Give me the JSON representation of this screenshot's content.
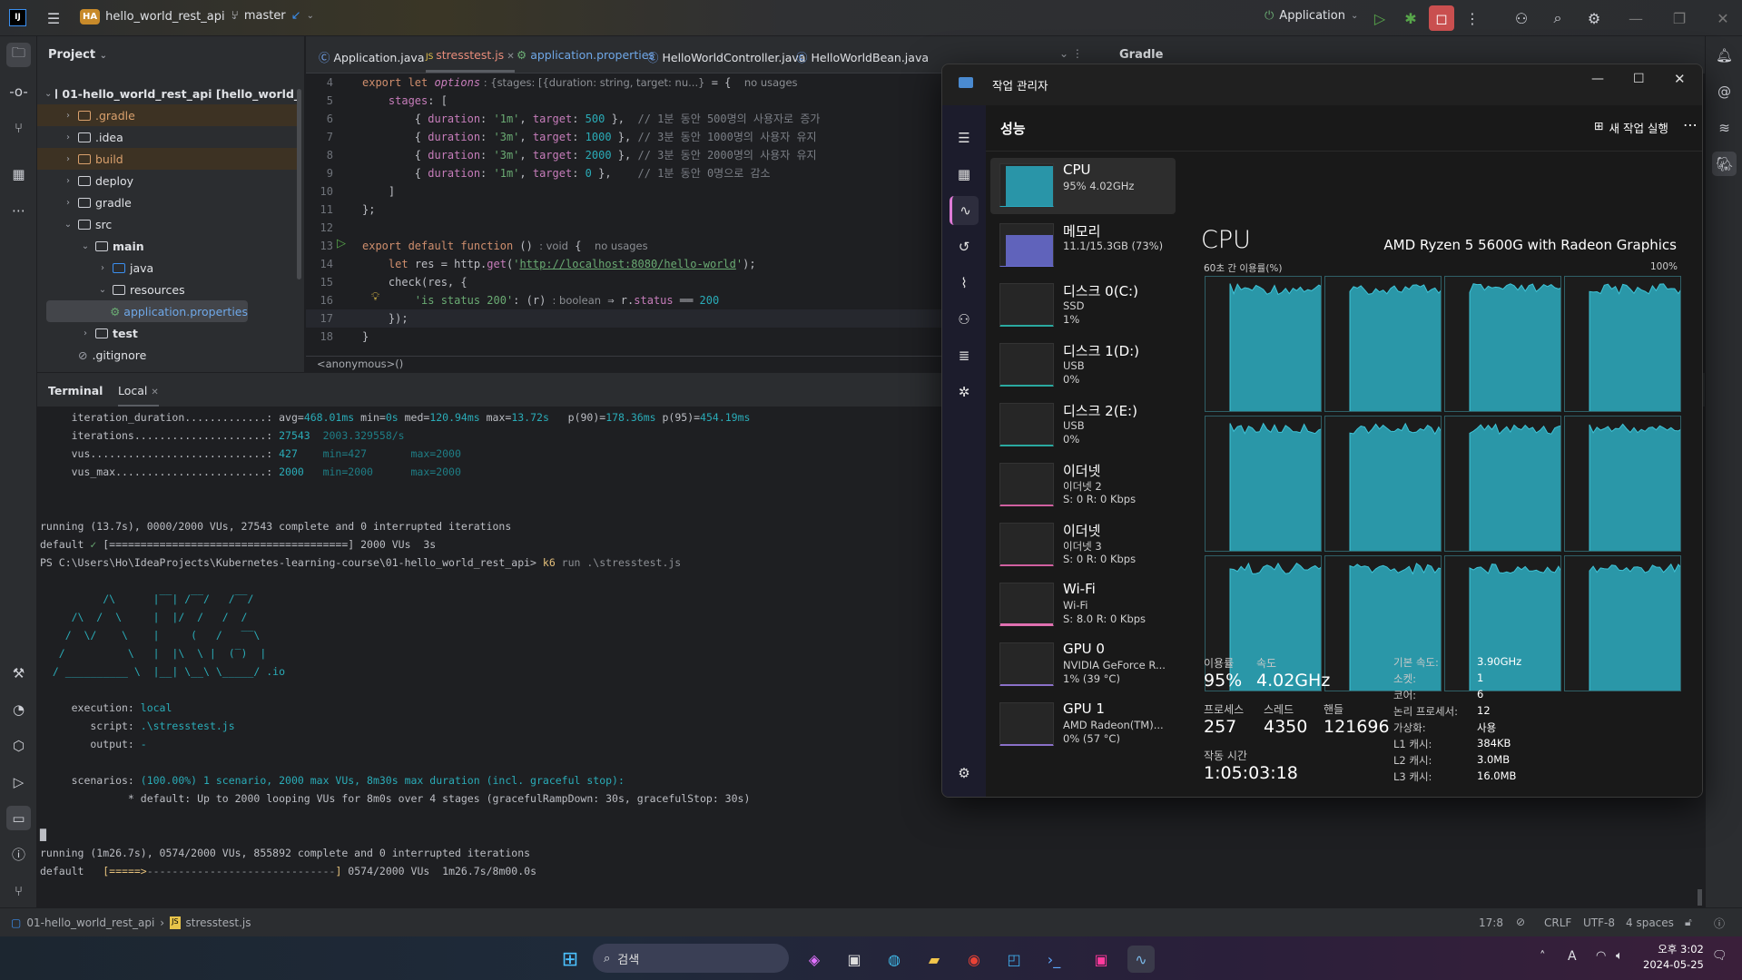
{
  "ide": {
    "project_badge": "HA",
    "project_name": "hello_world_rest_api",
    "branch": "master",
    "run_config": "Application",
    "project_panel_title": "Project",
    "tree": [
      {
        "label": "01-hello_world_rest_api [hello_world_rest_api]",
        "depth": 0,
        "chev": "⌄",
        "type": "module"
      },
      {
        "label": ".gradle",
        "depth": 1,
        "chev": "›",
        "type": "excluded"
      },
      {
        "label": ".idea",
        "depth": 1,
        "chev": "›",
        "type": "folder"
      },
      {
        "label": "build",
        "depth": 1,
        "chev": "›",
        "type": "excluded"
      },
      {
        "label": "deploy",
        "depth": 1,
        "chev": "›",
        "type": "folder"
      },
      {
        "label": "gradle",
        "depth": 1,
        "chev": "›",
        "type": "folder"
      },
      {
        "label": "src",
        "depth": 1,
        "chev": "⌄",
        "type": "folder"
      },
      {
        "label": "main",
        "depth": 2,
        "chev": "⌄",
        "type": "folder"
      },
      {
        "label": "java",
        "depth": 3,
        "chev": "›",
        "type": "folder"
      },
      {
        "label": "resources",
        "depth": 3,
        "chev": "⌄",
        "type": "folder"
      },
      {
        "label": "application.properties",
        "depth": 4,
        "chev": "",
        "type": "selected"
      },
      {
        "label": "test",
        "depth": 2,
        "chev": "›",
        "type": "folder"
      },
      {
        "label": ".gitignore",
        "depth": 1,
        "chev": "",
        "type": "file"
      }
    ],
    "tabs": [
      "Application.java",
      "stresstest.js",
      "application.properties",
      "HelloWorldController.java",
      "HelloWorldBean.java"
    ],
    "active_tab": "stresstest.js",
    "gradle_title": "Gradle",
    "code": [
      {
        "n": "4",
        "seg": [
          [
            "kw",
            "export let "
          ],
          [
            "it",
            "options"
          ],
          [
            "hint",
            " : {stages: [{duration: string, target: nu...}  "
          ],
          [
            "plain",
            "= {  "
          ],
          [
            "hint",
            "no usages"
          ]
        ]
      },
      {
        "n": "5",
        "seg": [
          [
            "plain",
            "    "
          ],
          [
            "prop",
            "stages"
          ],
          [
            "plain",
            ": ["
          ]
        ]
      },
      {
        "n": "6",
        "seg": [
          [
            "plain",
            "        { "
          ],
          [
            "prop",
            "duration"
          ],
          [
            "plain",
            ": "
          ],
          [
            "str",
            "'1m'"
          ],
          [
            "plain",
            ", "
          ],
          [
            "prop",
            "target"
          ],
          [
            "plain",
            ": "
          ],
          [
            "num",
            "500"
          ],
          [
            "plain",
            " },  "
          ],
          [
            "cmt",
            "// 1분 동안 500명의 사용자로 증가"
          ]
        ]
      },
      {
        "n": "7",
        "seg": [
          [
            "plain",
            "        { "
          ],
          [
            "prop",
            "duration"
          ],
          [
            "plain",
            ": "
          ],
          [
            "str",
            "'3m'"
          ],
          [
            "plain",
            ", "
          ],
          [
            "prop",
            "target"
          ],
          [
            "plain",
            ": "
          ],
          [
            "num",
            "1000"
          ],
          [
            "plain",
            " }, "
          ],
          [
            "cmt",
            "// 3분 동안 1000명의 사용자 유지"
          ]
        ]
      },
      {
        "n": "8",
        "seg": [
          [
            "plain",
            "        { "
          ],
          [
            "prop",
            "duration"
          ],
          [
            "plain",
            ": "
          ],
          [
            "str",
            "'3m'"
          ],
          [
            "plain",
            ", "
          ],
          [
            "prop",
            "target"
          ],
          [
            "plain",
            ": "
          ],
          [
            "num",
            "2000"
          ],
          [
            "plain",
            " }, "
          ],
          [
            "cmt",
            "// 3분 동안 2000명의 사용자 유지"
          ]
        ]
      },
      {
        "n": "9",
        "seg": [
          [
            "plain",
            "        { "
          ],
          [
            "prop",
            "duration"
          ],
          [
            "plain",
            ": "
          ],
          [
            "str",
            "'1m'"
          ],
          [
            "plain",
            ", "
          ],
          [
            "prop",
            "target"
          ],
          [
            "plain",
            ": "
          ],
          [
            "num",
            "0"
          ],
          [
            "plain",
            " },    "
          ],
          [
            "cmt",
            "// 1분 동안 0명으로 감소"
          ]
        ]
      },
      {
        "n": "10",
        "seg": [
          [
            "plain",
            "    ]"
          ]
        ]
      },
      {
        "n": "11",
        "seg": [
          [
            "plain",
            "};"
          ]
        ]
      },
      {
        "n": "12",
        "seg": []
      },
      {
        "n": "13",
        "seg": [
          [
            "kw",
            "export default function "
          ],
          [
            "plain",
            "() "
          ],
          [
            "hint",
            ": void  "
          ],
          [
            "plain",
            "{  "
          ],
          [
            "hint",
            "no usages"
          ]
        ]
      },
      {
        "n": "14",
        "seg": [
          [
            "plain",
            "    "
          ],
          [
            "kw",
            "let "
          ],
          [
            "plain",
            "res = http."
          ],
          [
            "prop",
            "get"
          ],
          [
            "plain",
            "("
          ],
          [
            "str",
            "'"
          ],
          [
            "link",
            "http://localhost:8080/hello-world"
          ],
          [
            "str",
            "'"
          ],
          [
            "plain",
            ");"
          ]
        ]
      },
      {
        "n": "15",
        "seg": [
          [
            "plain",
            "    check(res, {"
          ]
        ]
      },
      {
        "n": "16",
        "seg": [
          [
            "plain",
            "        "
          ],
          [
            "str",
            "'is status 200'"
          ],
          [
            "plain",
            ": (r) "
          ],
          [
            "hint",
            ": boolean  "
          ],
          [
            "plain",
            "⇒ r."
          ],
          [
            "prop",
            "status"
          ],
          [
            "plain",
            " ══ "
          ],
          [
            "num",
            "200"
          ]
        ]
      },
      {
        "n": "17",
        "seg": [
          [
            "plain",
            "    });"
          ]
        ]
      },
      {
        "n": "18",
        "seg": [
          [
            "plain",
            "}"
          ]
        ]
      }
    ],
    "breadcrumb": "<anonymous>()",
    "terminal_title": "Terminal",
    "terminal_tab": "Local",
    "terminal": [
      [
        [
          "",
          "     iteration_duration.............: "
        ],
        [
          "c-cyan",
          ""
        ],
        [
          "",
          "avg="
        ],
        [
          "c-cyan",
          "468.01ms"
        ],
        [
          "",
          " min="
        ],
        [
          "c-cyan",
          "0s"
        ],
        [
          "",
          " med="
        ],
        [
          "c-cyan",
          "120.94ms"
        ],
        [
          "",
          " max="
        ],
        [
          "c-cyan",
          "13.72s"
        ],
        [
          "",
          "   p(90)="
        ],
        [
          "c-cyan",
          "178.36ms"
        ],
        [
          "",
          " p(95)="
        ],
        [
          "c-cyan",
          "454.19ms"
        ]
      ],
      [
        [
          "",
          "     iterations.....................: "
        ],
        [
          "c-cyan",
          "27543"
        ],
        [
          "c-dim",
          "  2003.329558/s"
        ]
      ],
      [
        [
          "",
          "     vus............................: "
        ],
        [
          "c-cyan",
          "427"
        ],
        [
          "c-dim",
          "    min=427       max=2000"
        ]
      ],
      [
        [
          "",
          "     vus_max........................: "
        ],
        [
          "c-cyan",
          "2000"
        ],
        [
          "c-dim",
          "   min=2000      max=2000"
        ]
      ],
      [],
      [],
      [
        [
          "",
          "running (13.7s), 0000/2000 VUs, 27543 complete and 0 interrupted iterations"
        ]
      ],
      [
        [
          "",
          "default "
        ],
        [
          "c-grn",
          "✓"
        ],
        [
          "",
          " [======================================] 2000 VUs  3s"
        ]
      ],
      [
        [
          "",
          "PS C:\\Users\\Ho\\IdeaProjects\\Kubernetes-learning-course\\01-hello_world_rest_api> "
        ],
        [
          "c-yel",
          "k6"
        ],
        [
          "c-gray",
          " run .\\stresstest.js"
        ]
      ],
      [],
      [
        [
          "c-cyan",
          "          /\\      |‾‾| /‾‾/   /‾‾/"
        ]
      ],
      [
        [
          "c-cyan",
          "     /\\  /  \\     |  |/  /   /  /"
        ]
      ],
      [
        [
          "c-cyan",
          "    /  \\/    \\    |     (   /   ‾‾\\"
        ]
      ],
      [
        [
          "c-cyan",
          "   /          \\   |  |\\  \\ |  (‾)  |"
        ]
      ],
      [
        [
          "c-cyan",
          "  / __________ \\  |__| \\__\\ \\_____/ .io"
        ]
      ],
      [],
      [
        [
          "",
          "     execution: "
        ],
        [
          "c-cyan",
          "local"
        ]
      ],
      [
        [
          "",
          "        script: "
        ],
        [
          "c-cyan",
          ".\\stresstest.js"
        ]
      ],
      [
        [
          "",
          "        output: "
        ],
        [
          "c-cyan",
          "-"
        ]
      ],
      [],
      [
        [
          "",
          "     scenarios: "
        ],
        [
          "c-cyan",
          "(100.00%) 1 scenario, 2000 max VUs, 8m30s max duration (incl. graceful stop):"
        ]
      ],
      [
        [
          "",
          "              * default: Up to 2000 looping VUs for 8m0s over 4 stages (gracefulRampDown: 30s, gracefulStop: 30s)"
        ]
      ],
      [],
      [
        [
          "",
          "█"
        ]
      ],
      [
        [
          "",
          "running (1m26.7s), 0574/2000 VUs, 855892 complete and 0 interrupted iterations"
        ]
      ],
      [
        [
          "",
          "default   "
        ],
        [
          "c-yel",
          "[=====>"
        ],
        [
          "c-gray",
          "------------------------------"
        ],
        [
          "c-yel",
          "]"
        ],
        [
          "",
          " 0574/2000 VUs  1m26.7s/8m00.0s"
        ]
      ]
    ],
    "status": {
      "path": "01-hello_world_rest_api",
      "file": "stresstest.js",
      "pos": "17:8",
      "eol": "CRLF",
      "enc": "UTF-8",
      "indent": "4 spaces"
    }
  },
  "taskmgr": {
    "title": "작업 관리자",
    "section": "성능",
    "run_task": "새 작업 실행",
    "items": [
      {
        "name": "CPU",
        "sub1": "95% 4.02GHz",
        "sub2": "",
        "color": "#2aa9c0",
        "level": 95
      },
      {
        "name": "메모리",
        "sub1": "11.1/15.3GB (73%)",
        "sub2": "",
        "color": "#6b6fd6",
        "level": 73
      },
      {
        "name": "디스크 0(C:)",
        "sub1": "SSD",
        "sub2": "1%",
        "color": "#2aa9a0",
        "level": 1
      },
      {
        "name": "디스크 1(D:)",
        "sub1": "USB",
        "sub2": "0%",
        "color": "#2aa9a0",
        "level": 0
      },
      {
        "name": "디스크 2(E:)",
        "sub1": "USB",
        "sub2": "0%",
        "color": "#2aa9a0",
        "level": 0
      },
      {
        "name": "이더넷",
        "sub1": "이더넷 2",
        "sub2": "S: 0 R: 0 Kbps",
        "color": "#d060a0",
        "level": 0
      },
      {
        "name": "이더넷",
        "sub1": "이더넷 3",
        "sub2": "S: 0 R: 0 Kbps",
        "color": "#d060a0",
        "level": 0
      },
      {
        "name": "Wi-Fi",
        "sub1": "Wi-Fi",
        "sub2": "S: 8.0 R: 0 Kbps",
        "color": "#e070b0",
        "level": 5
      },
      {
        "name": "GPU 0",
        "sub1": "NVIDIA GeForce R...",
        "sub2": "1% (39 °C)",
        "color": "#8a70c8",
        "level": 1
      },
      {
        "name": "GPU 1",
        "sub1": "AMD Radeon(TM)...",
        "sub2": "0% (57 °C)",
        "color": "#8a70c8",
        "level": 0
      }
    ],
    "cpu": {
      "title": "CPU",
      "model": "AMD Ryzen 5 5600G with Radeon Graphics",
      "graph_label": "60초 간 이용률(%)",
      "graph_max": "100%",
      "cores": 12,
      "usage_percent": 95,
      "graph_color": "#2a97a8",
      "stats": {
        "util_lbl": "이용률",
        "util": "95%",
        "speed_lbl": "속도",
        "speed": "4.02GHz",
        "proc_lbl": "프로세스",
        "proc": "257",
        "thr_lbl": "스레드",
        "thr": "4350",
        "hnd_lbl": "핸들",
        "hnd": "121696",
        "up_lbl": "작동 시간",
        "up": "1:05:03:18"
      },
      "specs": [
        [
          "기본 속도:",
          "3.90GHz"
        ],
        [
          "소켓:",
          "1"
        ],
        [
          "코어:",
          "6"
        ],
        [
          "논리 프로세서:",
          "12"
        ],
        [
          "가상화:",
          "사용"
        ],
        [
          "L1 캐시:",
          "384KB"
        ],
        [
          "L2 캐시:",
          "3.0MB"
        ],
        [
          "L3 캐시:",
          "16.0MB"
        ]
      ]
    }
  },
  "taskbar": {
    "search": "검색",
    "time": "오후 3:02",
    "date": "2024-05-25"
  }
}
